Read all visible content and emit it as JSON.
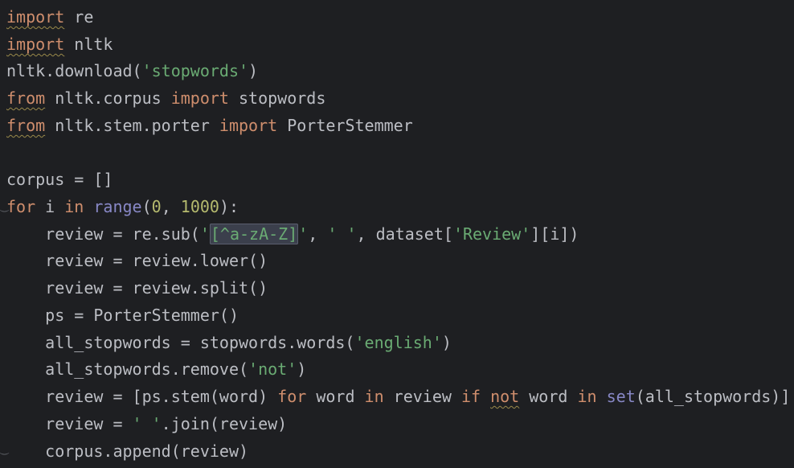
{
  "code": {
    "l1": {
      "k": "import",
      "t": " re"
    },
    "l2": {
      "k": "import",
      "t": " nltk"
    },
    "l3": {
      "a": "nltk.download(",
      "s": "'stopwords'",
      "b": ")"
    },
    "l4": {
      "k1": "from",
      "a": " nltk.corpus ",
      "k2": "import",
      "b": " stopwords"
    },
    "l5": {
      "k1": "from",
      "a": " nltk.stem.porter ",
      "k2": "import",
      "b": " PorterStemmer"
    },
    "l7": {
      "t": "corpus = []"
    },
    "l8": {
      "k1": "for",
      "a": " i ",
      "k2": "in",
      "sp": " ",
      "f": "range",
      "p1": "(",
      "n1": "0",
      "c": ", ",
      "n2": "1000",
      "p2": "):"
    },
    "l9": {
      "a": "    review = re.sub(",
      "q1": "'",
      "re": "[^a-zA-Z]",
      "q2": "'",
      "c1": ", ",
      "s2": "' '",
      "c2": ", dataset[",
      "s3": "'Review'",
      "b": "][i])"
    },
    "l10": {
      "t": "    review = review.lower()"
    },
    "l11": {
      "t": "    review = review.split()"
    },
    "l12": {
      "t": "    ps = PorterStemmer()"
    },
    "l13": {
      "a": "    all_stopwords = stopwords.words(",
      "s": "'english'",
      "b": ")"
    },
    "l14": {
      "a": "    all_stopwords.remove(",
      "s": "'not'",
      "b": ")"
    },
    "l15": {
      "a": "    review = [ps.stem(word) ",
      "k1": "for",
      "b": " word ",
      "k2": "in",
      "c": " review ",
      "k3": "if",
      "d": " ",
      "k4": "not",
      "e": " word ",
      "k5": "in",
      "f": " ",
      "g": "set",
      "h": "(all_stopwords)]"
    },
    "l16": {
      "a": "    review = ",
      "s": "' '",
      "b": ".join(review)"
    },
    "l17": {
      "t": "    corpus.append(review)"
    }
  },
  "icons": {
    "fold_open": "fold-open-icon",
    "fold_close": "fold-close-icon"
  },
  "colors": {
    "background": "#1e1f22",
    "keyword": "#cf8e6d",
    "string": "#6aab73",
    "number": "#2aacb8",
    "builtin": "#8888c6",
    "text": "#bcbec4"
  }
}
